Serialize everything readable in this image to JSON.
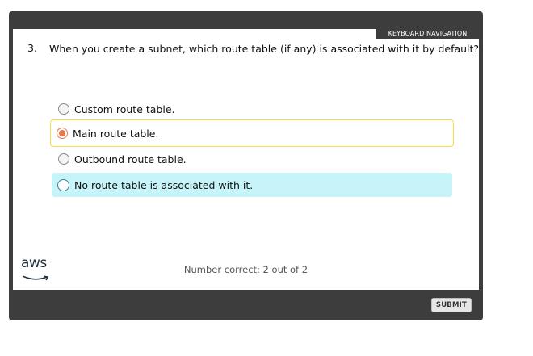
{
  "header": {
    "keyboard_nav_label": "KEYBOARD NAVIGATION"
  },
  "question": {
    "number": "3.",
    "text": "When you create a subnet, which route table (if any) is associated with it by default?"
  },
  "options": [
    {
      "label": "Custom route table.",
      "state": "unselected"
    },
    {
      "label": "Main route table.",
      "state": "selected"
    },
    {
      "label": "Outbound route table.",
      "state": "unselected"
    },
    {
      "label": "No route table is associated with it.",
      "state": "hovered"
    }
  ],
  "footer": {
    "logo_text": "aws",
    "score_text": "Number correct: 2 out of 2",
    "submit_label": "SUBMIT"
  },
  "colors": {
    "frame": "#3d3d3d",
    "selected_border": "#f5dd47",
    "selected_dot": "#e8774a",
    "hover_background": "#c7f4f9"
  }
}
